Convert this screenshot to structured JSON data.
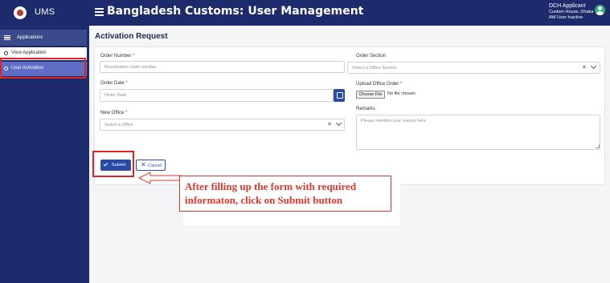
{
  "header": {
    "app_name": "UMS",
    "title": "Bangladesh Customs: User Management",
    "user_name": "DCH Applicant",
    "user_office": "Custom House, Dhaka",
    "user_status": "AW User Inactive"
  },
  "sidebar": {
    "section_label": "Applications",
    "items": [
      {
        "label": "View Application"
      },
      {
        "label": "User Activation"
      }
    ]
  },
  "page": {
    "title": "Activation Request"
  },
  "form": {
    "order_number": {
      "label": "Order Number",
      "required": "*",
      "placeholder": "Reactivation order number"
    },
    "order_date": {
      "label": "Order Date",
      "required": "*",
      "placeholder": "Order Date"
    },
    "new_office": {
      "label": "New Office",
      "required": "*",
      "placeholder": "Select a Office"
    },
    "order_section": {
      "label": "Order Section",
      "placeholder": "Select a Office Section"
    },
    "upload": {
      "label": "Upload Office Order",
      "required": "*",
      "button": "Choose File",
      "status": "No file chosen"
    },
    "remarks": {
      "label": "Remarks",
      "placeholder": "Please mention your reason here"
    },
    "clear_glyph": "✕"
  },
  "actions": {
    "submit_label": "Submit",
    "cancel_label": "Cancel",
    "cancel_glyph": "✕"
  },
  "annotation": {
    "text": "After filling up the form with required informaton, click on Submit button"
  },
  "colors": {
    "navy": "#1d2a6b",
    "primary": "#2a4aa8",
    "highlight": "#e02424",
    "annotation": "#d8392c"
  },
  "icons": [
    "emblem-icon",
    "hamburger-icon",
    "user-avatar-icon",
    "list-icon",
    "calendar-icon",
    "check-icon",
    "close-icon",
    "chevron-down-icon"
  ]
}
